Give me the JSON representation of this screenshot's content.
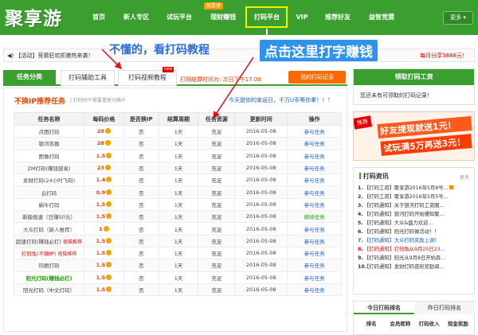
{
  "logo": "聚享游",
  "nav": {
    "items": [
      {
        "label": "首页"
      },
      {
        "label": "新人专区"
      },
      {
        "label": "试玩平台"
      },
      {
        "label": "理财赚钱"
      },
      {
        "label": "打码平台"
      },
      {
        "label": "VIP"
      },
      {
        "label": "推荐好友"
      },
      {
        "label": "益智竞猜"
      }
    ],
    "hot_tag": "就是快",
    "more": "更多"
  },
  "marquee": {
    "left": "【活动】竞猜狂欢抓猪热来袭！",
    "right": "每月分享5888元！"
  },
  "annotations": {
    "left": "不懂的，看打码教程",
    "right": "点击这里打字赚钱"
  },
  "tabs": {
    "category": "任务分类",
    "tools": "打码辅助工具",
    "video": "打码视频教程",
    "new_tag": "new",
    "settle": "打码结算时间为: 次日下午17:00",
    "my_records": "我的打码记录"
  },
  "section": {
    "title": "不换IP推荐任务",
    "subtitle": "| 打码时不需要重复切换IP",
    "signin": "今天是你的幸运日，千万U币等你拿！！！"
  },
  "table": {
    "headers": [
      "任务名称",
      "每码价格",
      "是否换IP",
      "结算周期",
      "任务资源",
      "更新时间",
      "操作"
    ],
    "rows": [
      {
        "name": "点图打码",
        "price": "28",
        "ip": "否",
        "cycle": "1天",
        "res": "充足",
        "date": "2016-05-08",
        "op": "参与任务"
      },
      {
        "name": "银河答题",
        "price": "28",
        "ip": "否",
        "cycle": "1天",
        "res": "充足",
        "date": "2016-05-08",
        "op": "参与任务"
      },
      {
        "name": "图像打码",
        "price": "1.5",
        "ip": "否",
        "cycle": "1天",
        "res": "充足",
        "date": "2016-05-08",
        "op": "参与任务"
      },
      {
        "name": "ZM打码(赚钱容易)",
        "price": "23",
        "ip": "否",
        "cycle": "1天",
        "res": "充足",
        "date": "2016-05-08",
        "op": "参与任务"
      },
      {
        "name": "发财打码(24小时飞码)",
        "price": "1.4",
        "ip": "否",
        "cycle": "1天",
        "res": "充足",
        "date": "2016-05-08",
        "op": "参与任务"
      },
      {
        "name": "云打码",
        "price": "0.9",
        "ip": "否",
        "cycle": "1天",
        "res": "充足",
        "date": "2016-05-08",
        "op": "参与任务"
      },
      {
        "name": "蜗牛打码",
        "price": "1.5",
        "ip": "否",
        "cycle": "1天",
        "res": "充足",
        "date": "2016-05-08",
        "op": "参与任务"
      },
      {
        "name": "新版极速（日赚50元）",
        "price": "1.5",
        "ip": "否",
        "cycle": "1天",
        "res": "充足",
        "date": "2016-05-08",
        "op": "继续任务"
      },
      {
        "name": "大众打码（新人推荐）",
        "price": "1",
        "ip": "否",
        "cycle": "1天",
        "res": "充足",
        "date": "2016-05-08",
        "op": "参与任务"
      },
      {
        "name": "超速打码(赚钱必打)",
        "rec": "夜猫推荐",
        "price": "1.5",
        "ip": "否",
        "cycle": "1天",
        "res": "充足",
        "date": "2016-05-08",
        "op": "参与任务"
      },
      {
        "name": "打码兔(不换IP)",
        "rec": "夜猫推荐",
        "price": "1.5",
        "ip": "否",
        "cycle": "1天",
        "res": "充足",
        "date": "2016-05-08",
        "op": "参与任务"
      },
      {
        "name": "玛丽打码",
        "price": "1.5",
        "ip": "否",
        "cycle": "1天",
        "res": "充足",
        "date": "2016-05-08",
        "op": "参与任务"
      },
      {
        "name": "阳光打码(赚钱必打)",
        "price": "1.5",
        "ip": "否",
        "cycle": "1天",
        "res": "充足",
        "date": "2016-05-08",
        "op": "参与任务"
      },
      {
        "name": "阳光打码（中文打码）",
        "price": "1.5",
        "ip": "否",
        "cycle": "1天",
        "res": "充足",
        "date": "2016-05-08",
        "op": "参与任务"
      }
    ]
  },
  "wage": {
    "title": "领取打码工资",
    "empty": "您还未有可领取的打码记录！"
  },
  "promo": {
    "tag": "推荐",
    "line1": "好友提现就送1元！",
    "line2": "试玩满5万再送3元！"
  },
  "news": {
    "title": "打码资讯",
    "more": "更多",
    "items": [
      "【打码工资】聚享游2016年5月8号...",
      "【打码工资】聚享游2016年5月5号...",
      "【打码通知】关于银河打码工资圈...",
      "【打码通知】银河打码开始攫知聚...",
      "【打码通知】大众&盛力欢迎...",
      "【打码通知】阳光打码做活动！！",
      "【打码通知】大众打码奖励上调!",
      "【打码通知】打码兔从9月25日23...",
      "【打码通知】阳光从9月8日开始奔...",
      "【打码通知】发财打码夜班奖励调..."
    ]
  },
  "rank": {
    "tab1": "今日打码排名",
    "tab2": "昨日打码排名",
    "cols": [
      "排名",
      "会员昵称",
      "打码收入",
      "现金奖励"
    ]
  }
}
